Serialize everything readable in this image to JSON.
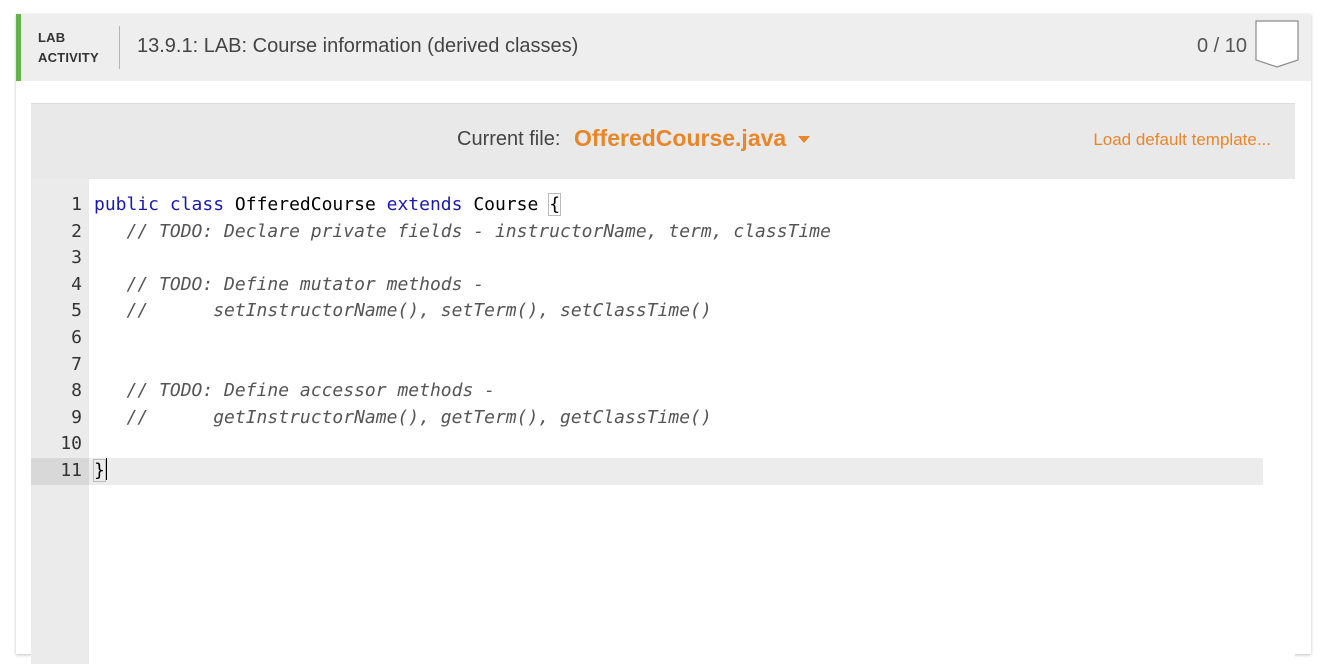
{
  "header": {
    "lab_type_line1": "LAB",
    "lab_type_line2": "ACTIVITY",
    "title": "13.9.1: LAB: Course information (derived classes)",
    "score": "0 / 10",
    "accent_color": "#6ab04c"
  },
  "file_bar": {
    "current_file_label": "Current file:",
    "current_file": "OfferedCourse.java",
    "load_template_label": "Load default template...",
    "accent_color": "#e8862a"
  },
  "editor": {
    "cursor_line": 11,
    "lines": [
      {
        "num": "1",
        "tokens": [
          [
            "kw",
            "public"
          ],
          [
            "t",
            " "
          ],
          [
            "kw",
            "class"
          ],
          [
            "t",
            " OfferedCourse "
          ],
          [
            "kw",
            "extends"
          ],
          [
            "t",
            " Course "
          ],
          [
            "b",
            "{"
          ]
        ]
      },
      {
        "num": "2",
        "tokens": [
          [
            "t",
            "   "
          ],
          [
            "cm",
            "// TODO: Declare private fields - instructorName, term, classTime"
          ]
        ]
      },
      {
        "num": "3",
        "tokens": []
      },
      {
        "num": "4",
        "tokens": [
          [
            "t",
            "   "
          ],
          [
            "cm",
            "// TODO: Define mutator methods -"
          ]
        ]
      },
      {
        "num": "5",
        "tokens": [
          [
            "t",
            "   "
          ],
          [
            "cm",
            "//      setInstructorName(), setTerm(), setClassTime()"
          ]
        ]
      },
      {
        "num": "6",
        "tokens": []
      },
      {
        "num": "7",
        "tokens": []
      },
      {
        "num": "8",
        "tokens": [
          [
            "t",
            "   "
          ],
          [
            "cm",
            "// TODO: Define accessor methods -"
          ]
        ]
      },
      {
        "num": "9",
        "tokens": [
          [
            "t",
            "   "
          ],
          [
            "cm",
            "//      getInstructorName(), getTerm(), getClassTime()"
          ]
        ]
      },
      {
        "num": "10",
        "tokens": []
      },
      {
        "num": "11",
        "tokens": [
          [
            "b",
            "}"
          ],
          [
            "cursor",
            ""
          ]
        ]
      }
    ]
  }
}
